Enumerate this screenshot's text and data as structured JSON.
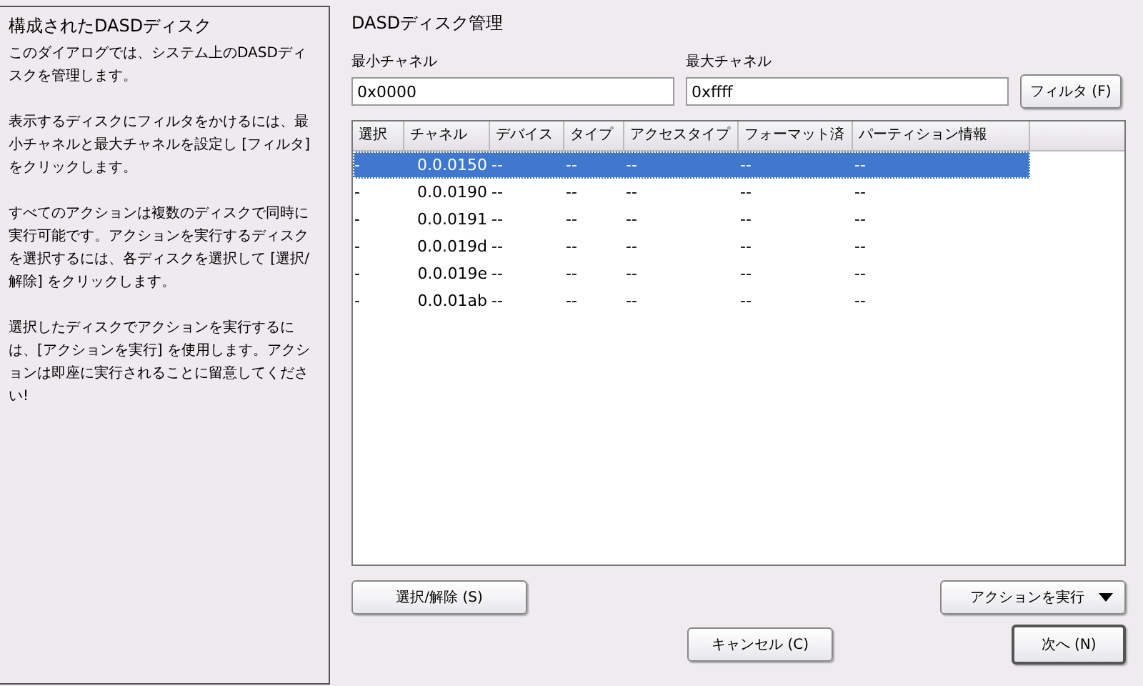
{
  "help": {
    "title": "構成されたDASDディスク",
    "paragraphs": [
      "このダイアログでは、システム上のDASDディスクを管理します。",
      "表示するディスクにフィルタをかけるには、最小チャネルと最大チャネルを設定し [フィルタ] をクリックします。",
      "すべてのアクションは複数のディスクで同時に実行可能です。アクションを実行するディスクを選択するには、各ディスクを選択して [選択/解除] をクリックします。",
      "選択したディスクでアクションを実行するには、[アクションを実行] を使用します。アクションは即座に実行されることに留意してください!"
    ]
  },
  "title": "DASDディスク管理",
  "filter": {
    "min_label": "最小チャネル",
    "min_value": "0x0000",
    "max_label": "最大チャネル",
    "max_value": "0xffff",
    "button": "フィルタ (F)"
  },
  "table": {
    "columns": [
      "選択",
      "チャネル",
      "デバイス",
      "タイプ",
      "アクセスタイプ",
      "フォーマット済",
      "パーティション情報"
    ],
    "rows": [
      {
        "cells": [
          "-",
          "0.0.0150",
          "--",
          "--",
          "--",
          "--",
          "--"
        ],
        "selected": true
      },
      {
        "cells": [
          "-",
          "0.0.0190",
          "--",
          "--",
          "--",
          "--",
          "--"
        ],
        "selected": false
      },
      {
        "cells": [
          "-",
          "0.0.0191",
          "--",
          "--",
          "--",
          "--",
          "--"
        ],
        "selected": false
      },
      {
        "cells": [
          "-",
          "0.0.019d",
          "--",
          "--",
          "--",
          "--",
          "--"
        ],
        "selected": false
      },
      {
        "cells": [
          "-",
          "0.0.019e",
          "--",
          "--",
          "--",
          "--",
          "--"
        ],
        "selected": false
      },
      {
        "cells": [
          "-",
          "0.0.01ab",
          "--",
          "--",
          "--",
          "--",
          "--"
        ],
        "selected": false
      }
    ]
  },
  "select_button": "選択/解除 (S)",
  "action_button": "アクションを実行",
  "buttons": [
    {
      "label": "キャンセル (C)",
      "default": false
    },
    {
      "label": "次へ (N)",
      "default": true
    }
  ]
}
